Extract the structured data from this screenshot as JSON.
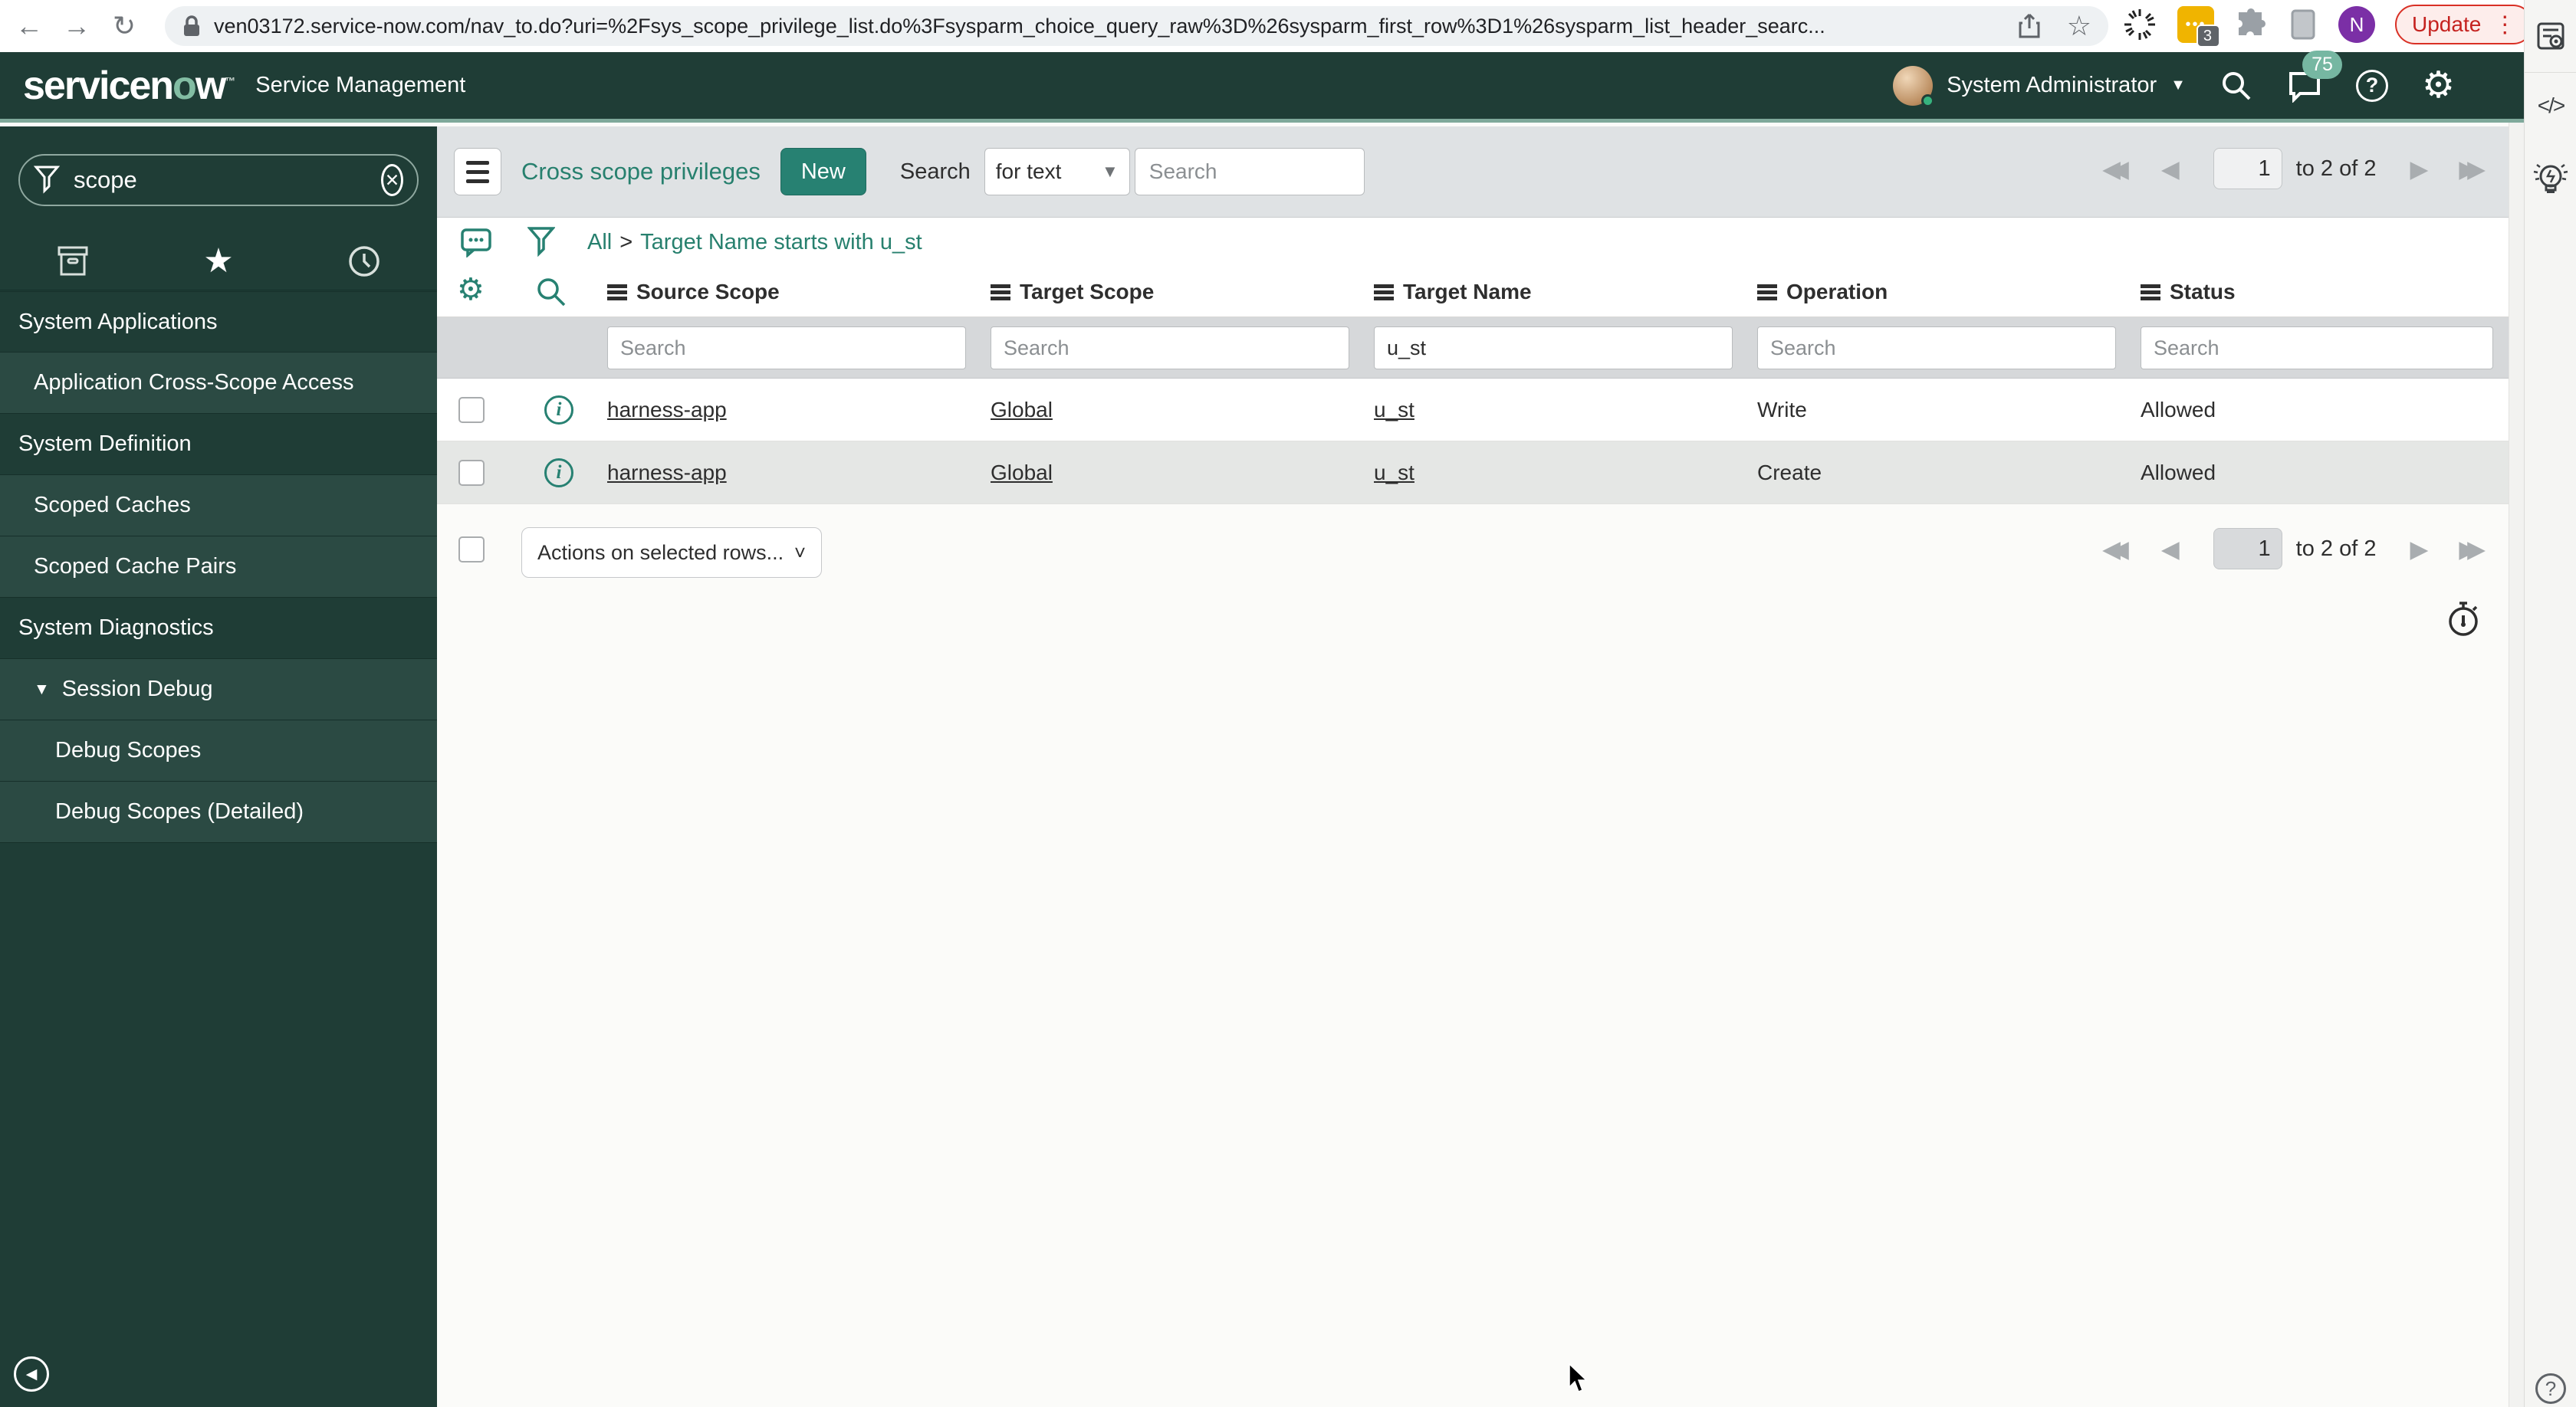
{
  "browser": {
    "url": "ven03172.service-now.com/nav_to.do?uri=%2Fsys_scope_privilege_list.do%3Fsysparm_choice_query_raw%3D%26sysparm_first_row%3D1%26sysparm_list_header_searc...",
    "update_label": "Update",
    "profile_initial": "N",
    "extension_badge": "3"
  },
  "app_header": {
    "logo_pre": "servicen",
    "logo_o": "o",
    "logo_post": "w",
    "product_title": "Service Management",
    "user_name": "System Administrator",
    "notification_count": "75"
  },
  "sidebar": {
    "filter_value": "scope",
    "items": [
      {
        "label": "System Applications",
        "type": "category"
      },
      {
        "label": "Application Cross-Scope Access",
        "type": "item"
      },
      {
        "label": "System Definition",
        "type": "category"
      },
      {
        "label": "Scoped Caches",
        "type": "item"
      },
      {
        "label": "Scoped Cache Pairs",
        "type": "item"
      },
      {
        "label": "System Diagnostics",
        "type": "category"
      },
      {
        "label": "Session Debug",
        "type": "item-expanded"
      },
      {
        "label": "Debug Scopes",
        "type": "subitem"
      },
      {
        "label": "Debug Scopes (Detailed)",
        "type": "subitem"
      }
    ]
  },
  "toolbar": {
    "title": "Cross scope privileges",
    "new_label": "New",
    "search_label": "Search",
    "search_type_value": "for text",
    "search_placeholder": "Search"
  },
  "breadcrumb": {
    "root": "All",
    "separator": ">",
    "condition": "Target Name starts with u_st"
  },
  "pagination": {
    "page": "1",
    "range_label": "to 2 of 2"
  },
  "table": {
    "columns": [
      "Source Scope",
      "Target Scope",
      "Target Name",
      "Operation",
      "Status"
    ],
    "search_placeholder": "Search",
    "search_values": [
      "",
      "",
      "u_st",
      "",
      ""
    ],
    "rows": [
      {
        "source_scope": "harness-app",
        "target_scope": "Global",
        "target_name": "u_st",
        "operation": "Write",
        "status": "Allowed"
      },
      {
        "source_scope": "harness-app",
        "target_scope": "Global",
        "target_name": "u_st",
        "operation": "Create",
        "status": "Allowed"
      }
    ],
    "actions_label": "Actions on selected rows..."
  },
  "icons": {
    "back": "←",
    "forward": "→",
    "reload": "↻",
    "bookmark_star": "☆",
    "kebab": "⋮",
    "code": "</>",
    "question": "?",
    "gear": "⚙",
    "favorites_star": "★",
    "caret_down": "▼",
    "select_caret": "▾",
    "chevron_down": "˅",
    "clear": "✕",
    "collapse": "◀",
    "info": "i",
    "pager_first": "◀◀",
    "pager_prev": "◀",
    "pager_next": "▶",
    "pager_last": "▶▶"
  },
  "colors": {
    "accent_teal": "#278172",
    "header_green": "#1F3D36",
    "sidebar_item_green": "#2B4A43",
    "update_red": "#C5221F",
    "badge_green": "#76B7A2",
    "extension_yellow": "#F0B400",
    "profile_purple": "#7B2FA6"
  }
}
